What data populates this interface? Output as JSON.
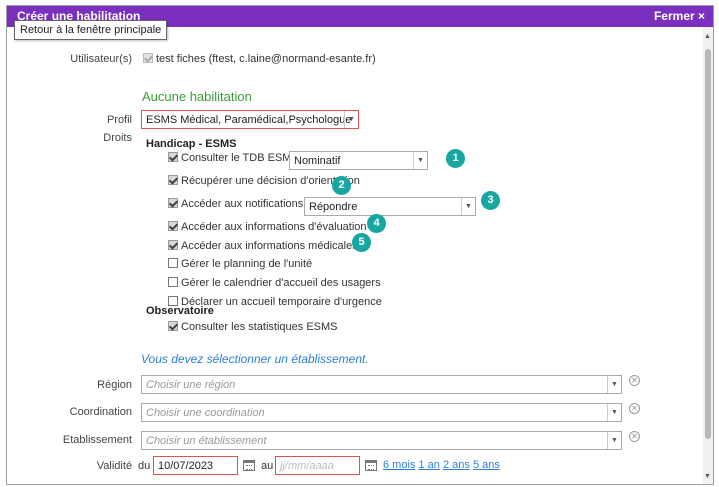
{
  "window": {
    "title": "Créer une habilitation",
    "close_label": "Fermer ×",
    "tooltip": "Retour à la fenêtre principale"
  },
  "form": {
    "user_label": "Utilisateur(s)",
    "user_value": "test fiches (ftest, c.laine@normand-esante.fr)",
    "no_habilitation": "Aucune habilitation",
    "profil_label": "Profil",
    "profil_value": "ESMS Médical, Paramédical,Psychologue",
    "droits_label": "Droits",
    "group1_title": "Handicap - ESMS",
    "rights": [
      {
        "label": "Consulter le TDB ESMS",
        "checked": true
      },
      {
        "label": "Récupérer une décision d'orientation",
        "checked": true
      },
      {
        "label": "Accéder aux notifications reçues",
        "checked": true
      },
      {
        "label": "Accéder aux informations d'évaluation",
        "checked": true
      },
      {
        "label": "Accéder aux informations médicales",
        "checked": true
      },
      {
        "label": "Gérer le planning de l'unité",
        "checked": false
      },
      {
        "label": "Gérer le calendrier d'accueil des usagers",
        "checked": false
      },
      {
        "label": "Déclarer un accueil temporaire d'urgence",
        "checked": false
      }
    ],
    "tdb_select": "Nominatif",
    "notif_select": "Répondre",
    "group2_title": "Observatoire",
    "observ_right": "Consulter les statistiques ESMS",
    "establishment_msg": "Vous devez sélectionner un établissement.",
    "region_label": "Région",
    "region_placeholder": "Choisir une région",
    "coord_label": "Coordination",
    "coord_placeholder": "Choisir une coordination",
    "etab_label": "Etablissement",
    "etab_placeholder": "Choisir un établissement",
    "validite_label": "Validité",
    "du_label": "du",
    "date_from": "10/07/2023",
    "au_label": "au",
    "date_to_placeholder": "jj/mm/aaaa",
    "quick_ranges": [
      "6 mois",
      "1 an",
      "2 ans",
      "5 ans"
    ]
  },
  "badges": [
    "1",
    "2",
    "3",
    "4",
    "5"
  ],
  "colors": {
    "titlebar": "#7b2fbe",
    "badge": "#18a6a0",
    "accent_green": "#3a9b3a",
    "link_blue": "#2d7fd3",
    "error_red": "#d9534f"
  }
}
